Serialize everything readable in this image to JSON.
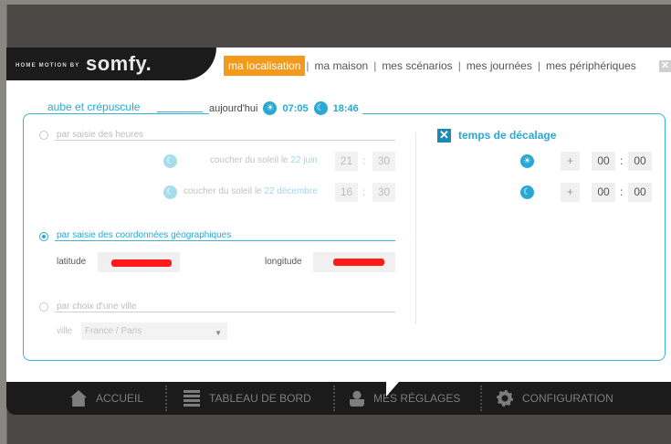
{
  "brand": {
    "tagline": "HOME MOTION BY",
    "name": "somfy."
  },
  "tabs": [
    {
      "label": "ma localisation",
      "active": true
    },
    {
      "label": "ma maison"
    },
    {
      "label": "mes scénarios"
    },
    {
      "label": "mes journées"
    },
    {
      "label": "mes périphériques"
    }
  ],
  "tab_separator": "|",
  "close_icon": "close-icon",
  "section": {
    "title": "aube et crépuscule",
    "today_label": "aujourd'hui",
    "sunrise_time": "07:05",
    "sunset_time": "18:46"
  },
  "options": {
    "hours": {
      "label": "par saisie des heures",
      "selected": false,
      "summer_label": "coucher du soleil le",
      "summer_date": "22 juin",
      "summer_h": "21",
      "summer_m": "30",
      "winter_label": "coucher du soleil le",
      "winter_date": "22 décembre",
      "winter_h": "16",
      "winter_m": "30"
    },
    "coords": {
      "label": "par saisie des coordonnées géographiques",
      "selected": true,
      "latitude_label": "latitude",
      "longitude_label": "longitude"
    },
    "city": {
      "label": "par choix d'une ville",
      "selected": false,
      "city_label": "ville",
      "city_value": "France / Paris"
    }
  },
  "offset": {
    "title": "temps de décalage",
    "checked": true,
    "sunrise": {
      "sign": "+",
      "h": "00",
      "m": "00"
    },
    "sunset": {
      "sign": "+",
      "h": "00",
      "m": "00"
    }
  },
  "time_separator": ":",
  "nav": [
    {
      "label": "ACCUEIL",
      "icon": "home-icon"
    },
    {
      "label": "TABLEAU DE BORD",
      "icon": "dashboard-icon"
    },
    {
      "label": "MES RÉGLAGES",
      "icon": "user-icon",
      "active": true
    },
    {
      "label": "CONFIGURATION",
      "icon": "gear-icon"
    }
  ],
  "colors": {
    "accent": "#2aa8d4",
    "active_tab": "#f39a1d",
    "nav_bg": "#1b1b1b"
  }
}
